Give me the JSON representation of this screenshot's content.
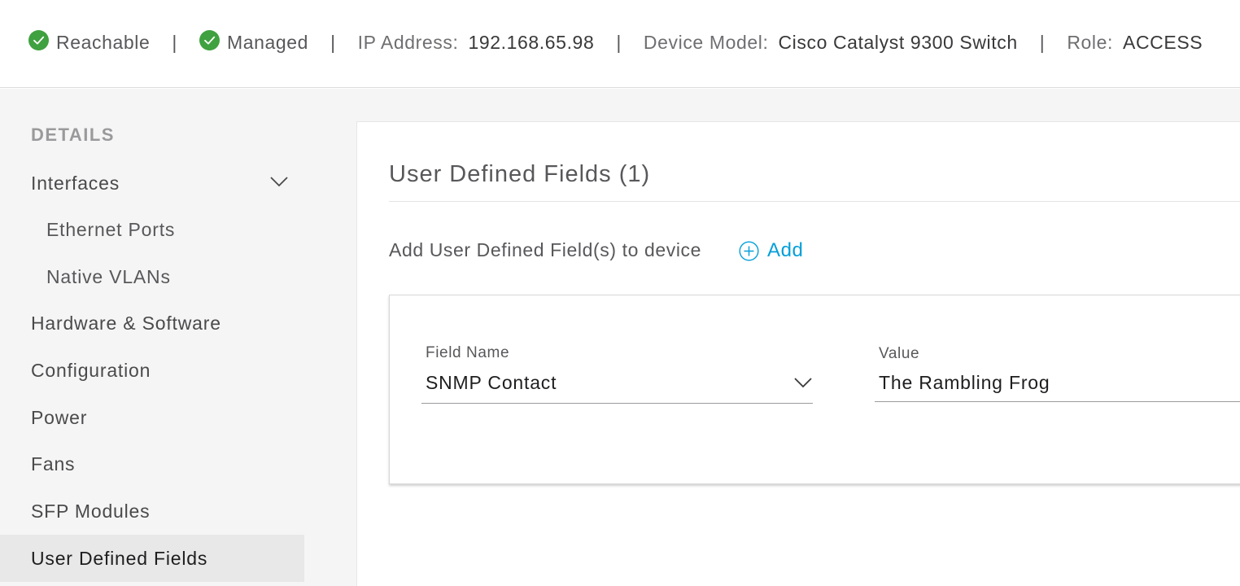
{
  "status": {
    "reachable": "Reachable",
    "managed": "Managed",
    "separator": "|",
    "ip_label": "IP Address:",
    "ip_value": "192.168.65.98",
    "model_label": "Device Model:",
    "model_value": "Cisco Catalyst 9300 Switch",
    "role_label": "Role:",
    "role_value": "ACCESS",
    "success_color": "#3fa13f"
  },
  "sidebar": {
    "heading": "DETAILS",
    "items": [
      {
        "label": "Interfaces",
        "icon": "chevron-down-icon"
      },
      {
        "label": "Ethernet Ports"
      },
      {
        "label": "Native VLANs"
      },
      {
        "label": "Hardware & Software"
      },
      {
        "label": "Configuration"
      },
      {
        "label": "Power"
      },
      {
        "label": "Fans"
      },
      {
        "label": "SFP Modules"
      },
      {
        "label": "User Defined Fields",
        "active": true
      }
    ]
  },
  "main": {
    "title": "User Defined Fields (1)",
    "add_description": "Add User Defined Field(s) to device",
    "add_label": "Add",
    "accent_color": "#049fd9",
    "field": {
      "name_label": "Field Name",
      "name_value": "SNMP Contact",
      "value_label": "Value",
      "value_value": "The Rambling Frog"
    }
  }
}
